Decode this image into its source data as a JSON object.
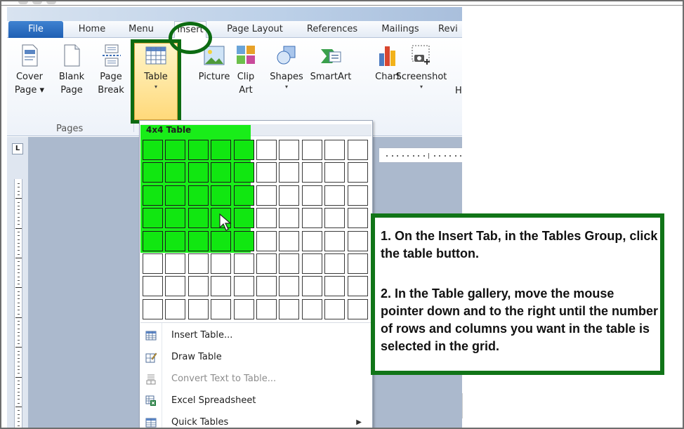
{
  "ribbon_tabs": [
    "File",
    "Home",
    "Menu",
    "Insert",
    "Page Layout",
    "References",
    "Mailings",
    "Revi"
  ],
  "ribbon_buttons": {
    "cover_page": [
      "Cover",
      "Page"
    ],
    "blank_page": [
      "Blank",
      "Page"
    ],
    "page_break": [
      "Page",
      "Break"
    ],
    "table": "Table",
    "picture": "Picture",
    "clip_art": [
      "Clip",
      "Art"
    ],
    "shapes": "Shapes",
    "smartart": "SmartArt",
    "chart": "Chart",
    "screenshot": "Screenshot",
    "partial": "H"
  },
  "groups": {
    "pages": "Pages"
  },
  "ruler_tab": "L",
  "table_gallery": {
    "title": "4x4 Table",
    "grid_columns": 10,
    "grid_rows": 8,
    "highlighted_columns": 5,
    "highlighted_rows": 5
  },
  "menu_items": [
    {
      "label": "Insert Table...",
      "icon": "insert-table-icon",
      "disabled": false
    },
    {
      "label": "Draw Table",
      "icon": "draw-table-icon",
      "disabled": false
    },
    {
      "label": "Convert Text to Table...",
      "icon": "convert-text-icon",
      "disabled": true
    },
    {
      "label": "Excel Spreadsheet",
      "icon": "excel-spreadsheet-icon",
      "disabled": false
    },
    {
      "label": "Quick Tables",
      "icon": "quick-tables-icon",
      "disabled": false,
      "submenu": true
    }
  ],
  "instructions": [
    "1. On the Insert Tab, in the Tables Group, click the table button.",
    "2. In the Table gallery, move the mouse pointer down and to the right until the number of rows and columns you want in the table is selected in the grid."
  ],
  "colors": {
    "highlight_green": "#19ed19",
    "annotation_green": "#0c6b12",
    "file_tab": "#2a6cc4"
  }
}
